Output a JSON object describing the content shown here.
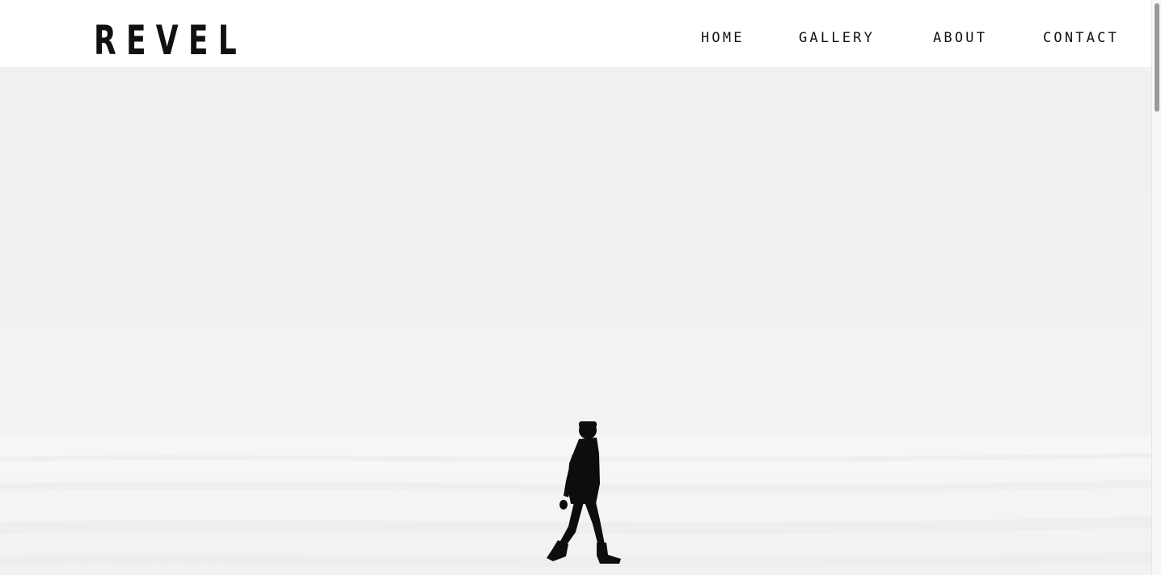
{
  "site": {
    "logo_text": "REVEL"
  },
  "nav": {
    "items": [
      {
        "label": "HOME"
      },
      {
        "label": "GALLERY"
      },
      {
        "label": "ABOUT"
      },
      {
        "label": "CONTACT"
      }
    ]
  },
  "hero": {
    "image_subject": "person-walking-on-snow",
    "colors": {
      "sky": "#f1f1f1",
      "snow": "#f6f6f6",
      "figure": "#0d0d0d"
    }
  }
}
